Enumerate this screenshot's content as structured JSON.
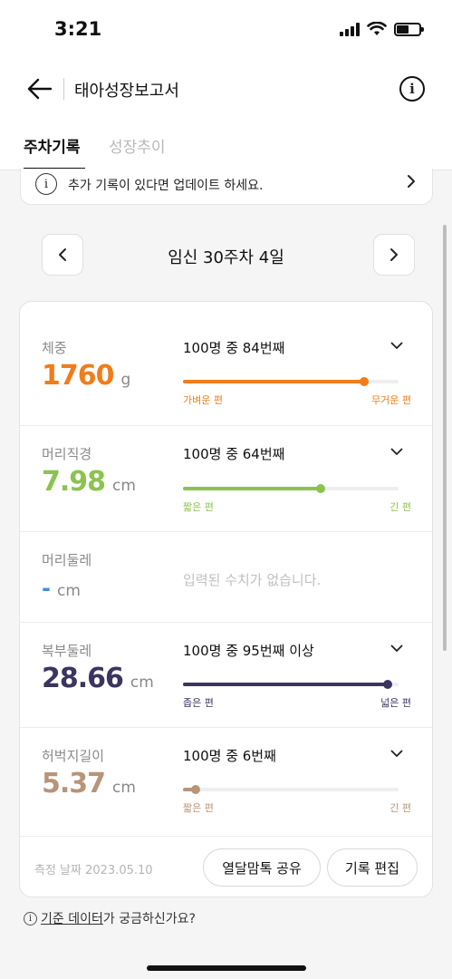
{
  "status_bar": {
    "time": "3:21"
  },
  "header": {
    "title": "태아성장보고서"
  },
  "tabs": {
    "active": "주차기록",
    "inactive": "성장추이"
  },
  "notice": {
    "text": "추가 기록이 있다면 업데이트 하세요."
  },
  "week": {
    "label": "임신 30주차 4일"
  },
  "metrics": [
    {
      "label": "체중",
      "value": "1760",
      "unit": "g",
      "rank": "100명 중 84번째",
      "low": "가벼운 편",
      "high": "무거운 편",
      "color": "#f07d1a",
      "position": 0.84
    },
    {
      "label": "머리직경",
      "value": "7.98",
      "unit": "cm",
      "rank": "100명 중 64번째",
      "low": "짧은 편",
      "high": "긴 편",
      "color": "#8cc34f",
      "position": 0.64
    },
    {
      "label": "머리둘레",
      "value": "-",
      "unit": "cm",
      "empty": "입력된 수치가 없습니다.",
      "color": "#3d8fe0"
    },
    {
      "label": "복부둘레",
      "value": "28.66",
      "unit": "cm",
      "rank": "100명 중 95번째 이상",
      "low": "좁은 편",
      "high": "넓은 편",
      "color": "#3b3560",
      "position": 0.95
    },
    {
      "label": "허벅지길이",
      "value": "5.37",
      "unit": "cm",
      "rank": "100명 중 6번째",
      "low": "짧은 편",
      "high": "긴 편",
      "color": "#b89478",
      "position": 0.06
    }
  ],
  "footer": {
    "measure_date": "측정 날짜 2023.05.10",
    "share_label": "열달맘톡 공유",
    "edit_label": "기록 편집"
  },
  "help": {
    "link_text": "기준 데이터",
    "rest_text": "가 궁금하신가요?"
  }
}
